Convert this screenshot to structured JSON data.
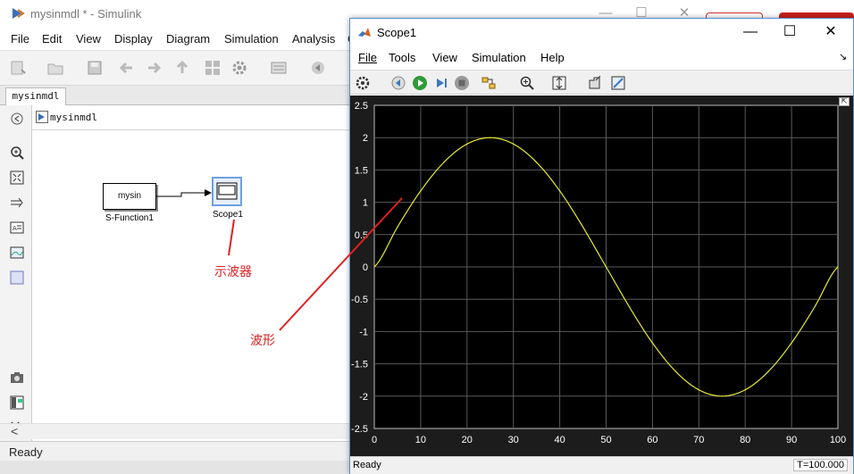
{
  "simulink": {
    "title": "mysinmdl * - Simulink",
    "window_controls": [
      "—",
      "☐",
      "✕"
    ],
    "menu": [
      "File",
      "Edit",
      "View",
      "Display",
      "Diagram",
      "Simulation",
      "Analysis",
      "C"
    ],
    "tab_label": "mysinmdl",
    "breadcrumb": "mysinmdl",
    "status": "Ready",
    "blocks": {
      "sfunction": {
        "text": "mysin",
        "label": "S-Function1"
      },
      "scope": {
        "label": "Scope1"
      }
    },
    "annotations": {
      "scope_note": "示波器",
      "wave_note": "波形"
    },
    "scroll_left": "<"
  },
  "scope": {
    "title": "Scope1",
    "menu": [
      "File",
      "Tools",
      "View",
      "Simulation",
      "Help"
    ],
    "status": "Ready",
    "time_readout": "T=100.000",
    "corner_arrow": "↘"
  },
  "colors": {
    "annotation_red": "#e02020",
    "plot_background": "#000000",
    "trace_yellow": "#e8e830",
    "grid_gray": "#5a5a5a",
    "axis_text": "#ffffff"
  },
  "icons": [
    "simulink-logo-icon",
    "matlab-logo-icon",
    "scope-block-icon"
  ],
  "chart_data": {
    "type": "line",
    "title": "",
    "xlabel": "",
    "ylabel": "",
    "xlim": [
      0,
      100
    ],
    "ylim": [
      -2.5,
      2.5
    ],
    "x_ticks": [
      "0",
      "10",
      "20",
      "30",
      "40",
      "50",
      "60",
      "70",
      "80",
      "90",
      "100"
    ],
    "y_ticks": [
      "2.5",
      "2",
      "1.5",
      "1",
      "0.5",
      "0",
      "-0.5",
      "-1",
      "-1.5",
      "-2",
      "-2.5"
    ],
    "grid": true,
    "series": [
      {
        "color": "#e8e830",
        "x": [
          0,
          5,
          10,
          15,
          20,
          25,
          30,
          35,
          40,
          45,
          50,
          55,
          60,
          65,
          70,
          75,
          80,
          85,
          90,
          95,
          100
        ],
        "y": [
          0,
          0.618,
          1.176,
          1.618,
          1.902,
          2.0,
          1.902,
          1.618,
          1.176,
          0.618,
          0,
          -0.618,
          -1.176,
          -1.618,
          -1.902,
          -2.0,
          -1.902,
          -1.618,
          -1.176,
          -0.618,
          0
        ]
      }
    ]
  }
}
